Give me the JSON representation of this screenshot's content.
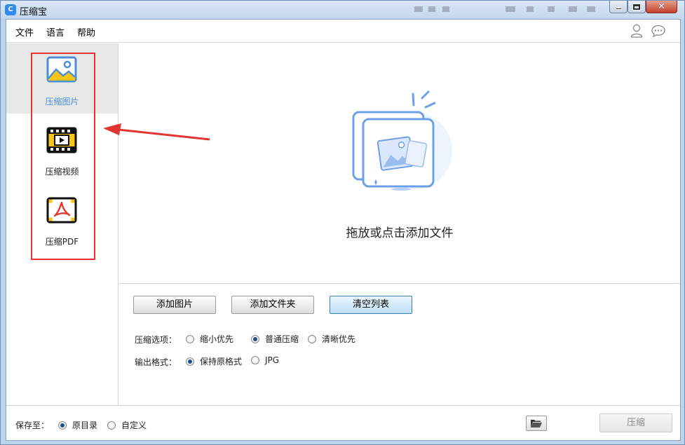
{
  "window": {
    "title": "压缩宝",
    "app_icon_glyph": "C"
  },
  "menu": {
    "file": "文件",
    "language": "语言",
    "help": "帮助"
  },
  "header_icons": {
    "user": "user-icon",
    "chat": "chat-icon"
  },
  "sidebar": {
    "items": [
      {
        "label": "压缩图片",
        "icon": "image-icon",
        "active": true
      },
      {
        "label": "压缩视频",
        "icon": "video-icon",
        "active": false
      },
      {
        "label": "压缩PDF",
        "icon": "pdf-icon",
        "active": false
      }
    ]
  },
  "dropzone": {
    "text": "拖放或点击添加文件"
  },
  "buttons": {
    "add_image": "添加图片",
    "add_folder": "添加文件夹",
    "clear_list": "清空列表"
  },
  "compress_options": {
    "label": "压缩选项：",
    "options": [
      "缩小优先",
      "普通压缩",
      "清晰优先"
    ],
    "selected": "普通压缩"
  },
  "output_format": {
    "label": "输出格式：",
    "options": [
      "保持原格式",
      "JPG"
    ],
    "selected": "保持原格式"
  },
  "footer": {
    "save_to_label": "保存至：",
    "options": [
      "原目录",
      "自定义"
    ],
    "selected": "原目录",
    "compress_button": "压缩"
  },
  "colors": {
    "accent": "#4a8fd6",
    "annotation_red": "#e33333",
    "icon_yellow": "#f5c518"
  }
}
